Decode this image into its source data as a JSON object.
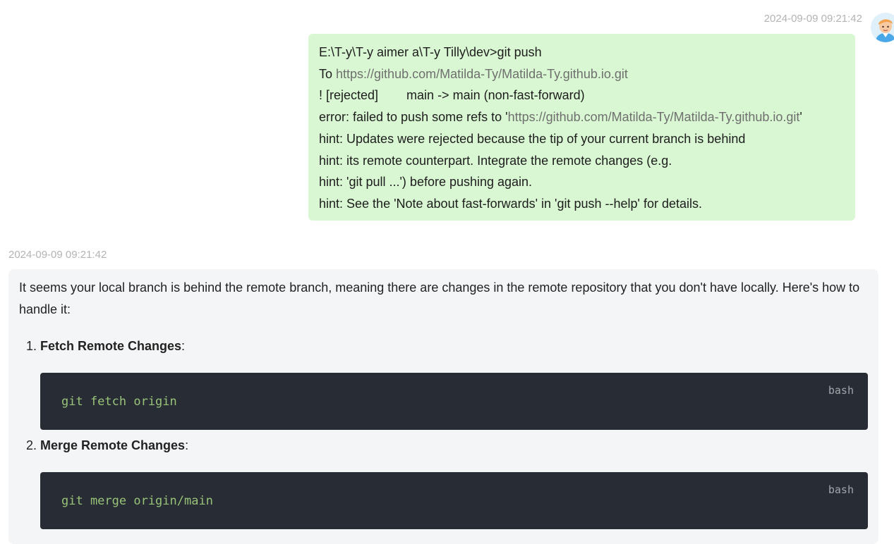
{
  "user_message": {
    "timestamp": "2024-09-09 09:21:42",
    "avatar_icon": "user-avatar-icon",
    "bubble_color": "#d9f7d2",
    "lines": [
      {
        "text": "E:\\T-y\\T-y aimer a\\T-y Tilly\\dev>git push"
      },
      {
        "prefix": "To ",
        "link": "https://github.com/Matilda-Ty/Matilda-Ty.github.io.git",
        "suffix": ""
      },
      {
        "text": "! [rejected]        main -> main (non-fast-forward)"
      },
      {
        "prefix": "error: failed to push some refs to '",
        "link": "https://github.com/Matilda-Ty/Matilda-Ty.github.io.git",
        "suffix": "'"
      },
      {
        "text": "hint: Updates were rejected because the tip of your current branch is behind"
      },
      {
        "text": "hint: its remote counterpart. Integrate the remote changes (e.g."
      },
      {
        "text": "hint: 'git pull ...') before pushing again."
      },
      {
        "text": "hint: See the 'Note about fast-forwards' in 'git push --help' for details."
      }
    ]
  },
  "assistant_message": {
    "timestamp": "2024-09-09 09:21:42",
    "bubble_color": "#f4f5f7",
    "intro": "It seems your local branch is behind the remote branch, meaning there are changes in the remote repository that you don't have locally. Here's how to handle it:",
    "steps": [
      {
        "title": "Fetch Remote Changes",
        "suffix": ":",
        "code": {
          "language": "bash",
          "content": "git fetch origin"
        }
      },
      {
        "title": "Merge Remote Changes",
        "suffix": ":",
        "code": {
          "language": "bash",
          "content": "git merge origin/main"
        }
      }
    ]
  }
}
